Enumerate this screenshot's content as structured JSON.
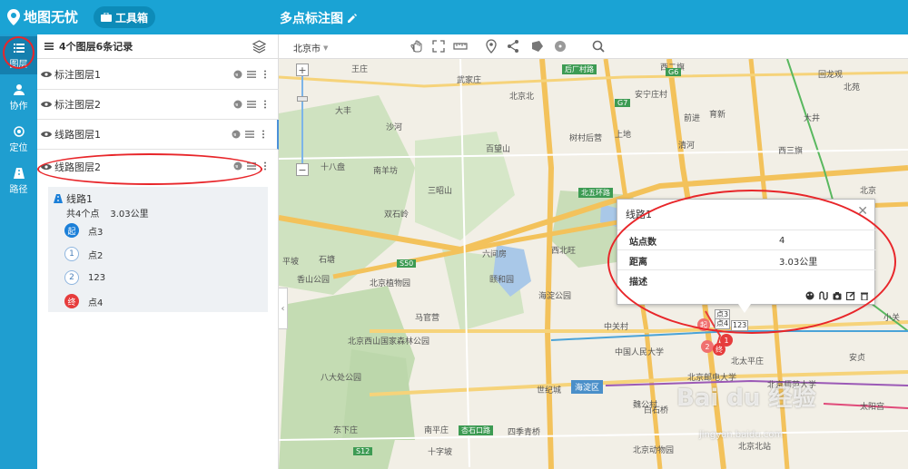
{
  "header": {
    "brand": "地图无忧",
    "toolbox_label": "工具箱",
    "doc_title": "多点标注图"
  },
  "nav": {
    "items": [
      {
        "label": "图层",
        "icon": "layers-list-icon"
      },
      {
        "label": "协作",
        "icon": "people-icon"
      },
      {
        "label": "定位",
        "icon": "target-icon"
      },
      {
        "label": "路径",
        "icon": "route-icon"
      }
    ]
  },
  "panel": {
    "summary": "4个图层6条记录",
    "layers": [
      {
        "name": "标注图层1"
      },
      {
        "name": "标注图层2"
      },
      {
        "name": "线路图层1"
      },
      {
        "name": "线路图层2"
      }
    ],
    "route": {
      "name": "线路1",
      "points_text": "共4个点",
      "distance_text": "3.03公里",
      "stops": [
        {
          "badge": "起",
          "name": "点3",
          "kind": "start"
        },
        {
          "badge": "1",
          "name": "点2",
          "kind": "mid"
        },
        {
          "badge": "2",
          "name": "123",
          "kind": "mid"
        },
        {
          "badge": "终",
          "name": "点4",
          "kind": "end"
        }
      ]
    }
  },
  "maptools": {
    "city": "北京市"
  },
  "map": {
    "labels": [
      {
        "t": "王庄"
      },
      {
        "t": "武家庄"
      },
      {
        "t": "北京北"
      },
      {
        "t": "后厂村路"
      },
      {
        "t": "安宁庄村"
      },
      {
        "t": "西二旗"
      },
      {
        "t": "回龙观"
      },
      {
        "t": "前进"
      },
      {
        "t": "育新"
      },
      {
        "t": "大丰"
      },
      {
        "t": "百望山"
      },
      {
        "t": "树村后营"
      },
      {
        "t": "上地"
      },
      {
        "t": "清河"
      },
      {
        "t": "西三旗"
      },
      {
        "t": "大井"
      },
      {
        "t": "沙河"
      },
      {
        "t": "北京"
      },
      {
        "t": "南羊坊"
      },
      {
        "t": "十八盘"
      },
      {
        "t": "三昭山"
      },
      {
        "t": "双石岭"
      },
      {
        "t": "北五环路"
      },
      {
        "t": "西北旺"
      },
      {
        "t": "六间房"
      },
      {
        "t": "颐和园"
      },
      {
        "t": "北京植物园"
      },
      {
        "t": "海淀公园"
      },
      {
        "t": "中关村"
      },
      {
        "t": "北京西山国家森林公园"
      },
      {
        "t": "中国人民大学"
      },
      {
        "t": "北京邮电大学"
      },
      {
        "t": "北京师范大学"
      },
      {
        "t": "北太平庄"
      },
      {
        "t": "世纪城"
      },
      {
        "t": "海淀区"
      },
      {
        "t": "魏公村"
      },
      {
        "t": "白石桥"
      },
      {
        "t": "北京北站"
      },
      {
        "t": "四季青桥"
      },
      {
        "t": "杏石口路"
      },
      {
        "t": "八大处公园"
      },
      {
        "t": "东下庄"
      },
      {
        "t": "南平庄"
      },
      {
        "t": "十字坡"
      },
      {
        "t": "平坡"
      },
      {
        "t": "安贞"
      },
      {
        "t": "小关"
      },
      {
        "t": "太阳宫"
      },
      {
        "t": "北京动物园"
      },
      {
        "t": "北苑"
      },
      {
        "t": "石塘"
      },
      {
        "t": "马官营"
      },
      {
        "t": "香山公园"
      },
      {
        "t": "S50"
      },
      {
        "t": "G6"
      },
      {
        "t": "G7"
      },
      {
        "t": "S12"
      }
    ]
  },
  "popup": {
    "title": "线路1",
    "rows": [
      {
        "k": "站点数",
        "v": "4"
      },
      {
        "k": "距离",
        "v": "3.03公里"
      },
      {
        "k": "描述",
        "v": ""
      }
    ]
  },
  "markers": [
    {
      "label": "点3"
    },
    {
      "label": "点4"
    },
    {
      "label": "123"
    }
  ],
  "watermark": {
    "text": "Bai du 经验",
    "sub": "jingyan.baidu.com"
  },
  "colors": {
    "topbar": "#1aa3d4",
    "nav": "#1f9ed0",
    "annotation_red": "#e8262a",
    "start_blue": "#1b7fd8",
    "end_red": "#e63c3c"
  }
}
